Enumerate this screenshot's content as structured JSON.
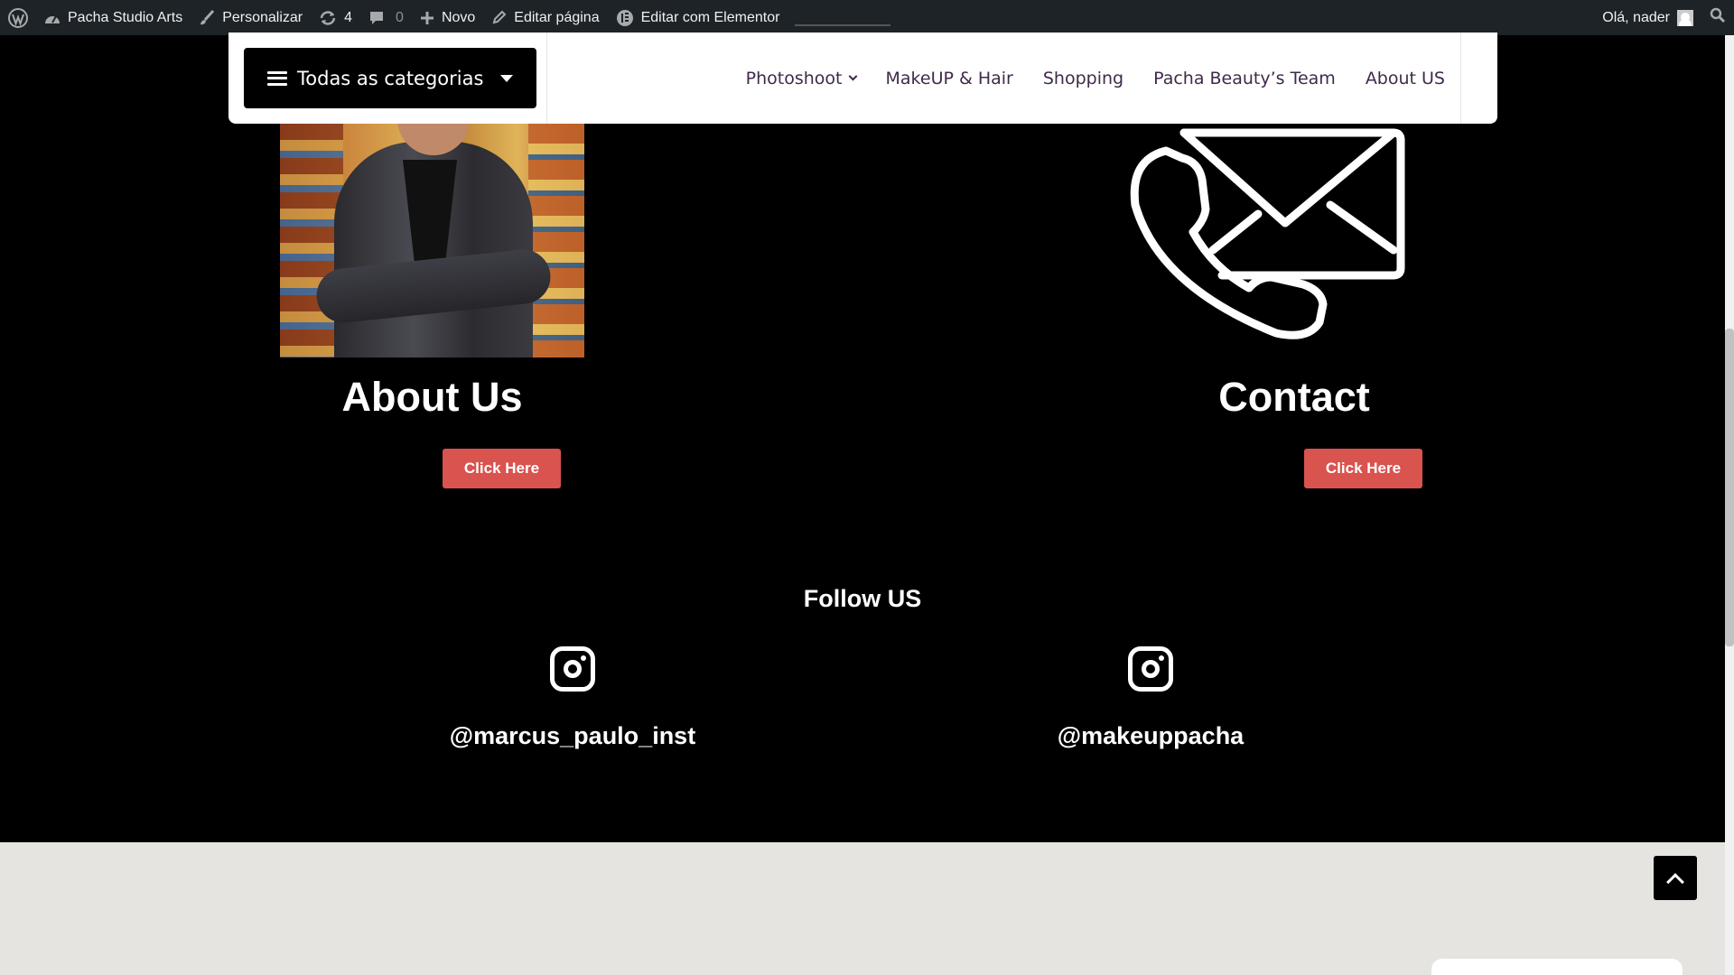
{
  "admin_bar": {
    "site_name": "Pacha Studio Arts",
    "customize": "Personalizar",
    "updates_count": "4",
    "comments_count": "0",
    "new": "Novo",
    "edit_page": "Editar página",
    "edit_elementor": "Editar com Elementor",
    "greeting": "Olá, nader"
  },
  "header": {
    "categories_button": "Todas as categorias",
    "nav": [
      {
        "label": "Photoshoot"
      },
      {
        "label": "MakeUP & Hair"
      },
      {
        "label": "Shopping"
      },
      {
        "label": "Pacha Beauty’s Team"
      },
      {
        "label": "About US"
      }
    ]
  },
  "sections": {
    "about": {
      "title": "About Us",
      "button": "Click Here"
    },
    "contact": {
      "title": "Contact",
      "button": "Click Here"
    }
  },
  "follow": {
    "title": "Follow US",
    "accounts": [
      {
        "handle": "@marcus_paulo_inst",
        "icon": "instagram-icon"
      },
      {
        "handle": "@makeuppacha",
        "icon": "instagram-icon"
      }
    ]
  },
  "colors": {
    "background": "#000000",
    "cta": "#d9534f",
    "nav_text": "#3f2a4a",
    "admin_bar": "#1d2327",
    "footer_bg": "#e5e4e1"
  }
}
